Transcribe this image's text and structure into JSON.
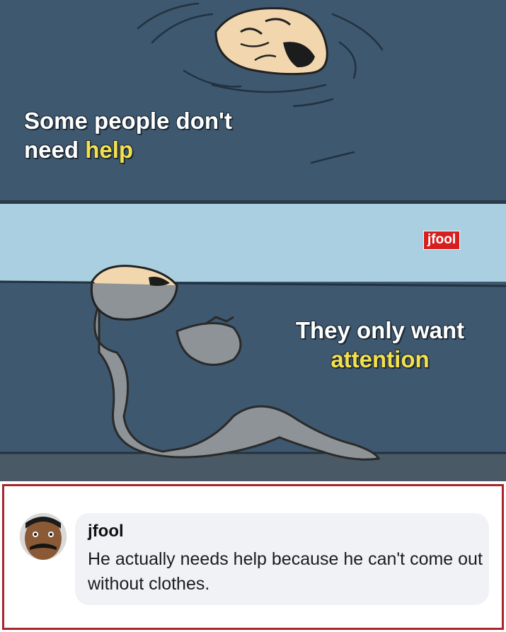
{
  "meme": {
    "top_caption": {
      "line1": "Some people don't",
      "line2_prefix": "need ",
      "line2_highlight": "help"
    },
    "bottom_caption": {
      "line1": "They only want",
      "line2_highlight": "attention"
    },
    "watermark": "jfool"
  },
  "comment": {
    "author": "jfool",
    "text": "He actually needs help because he can't come out without clothes."
  },
  "colors": {
    "water": "#3e5870",
    "sky": "#a9cfe0",
    "highlight": "#f4e04d",
    "frame": "#a6262c",
    "watermark_bg": "#d62020"
  }
}
